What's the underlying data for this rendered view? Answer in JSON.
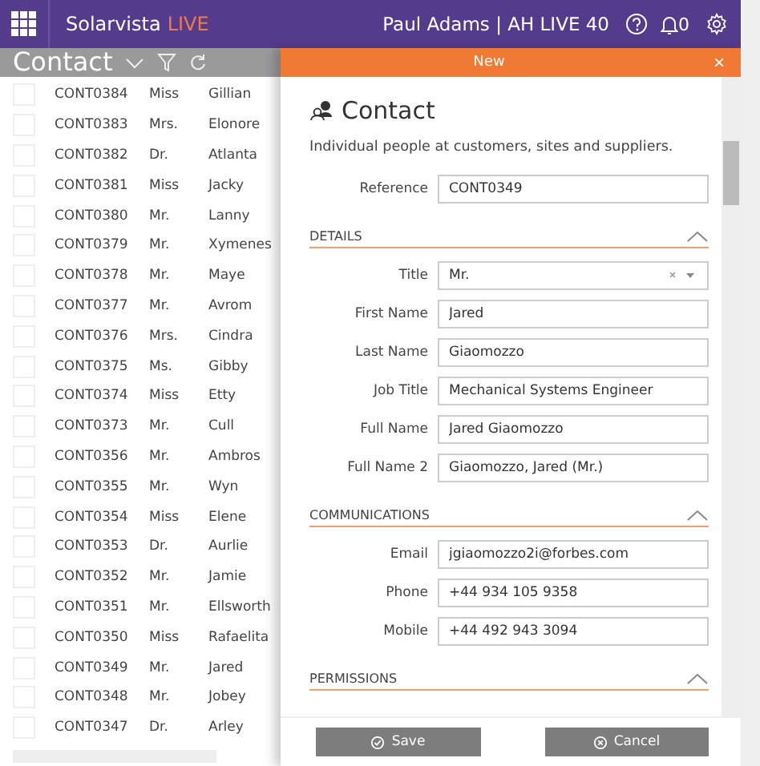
{
  "header": {
    "brand": "Solarvista",
    "brand_suffix": "LIVE",
    "user": "Paul Adams | AH LIVE 40",
    "notifications": "0"
  },
  "list_toolbar": {
    "title": "Contact"
  },
  "rows": [
    {
      "ref": "CONT0384",
      "title": "Miss",
      "name": "Gillian",
      "checked": false
    },
    {
      "ref": "CONT0383",
      "title": "Mrs.",
      "name": "Elonore",
      "checked": false
    },
    {
      "ref": "CONT0382",
      "title": "Dr.",
      "name": "Atlanta",
      "checked": false
    },
    {
      "ref": "CONT0381",
      "title": "Miss",
      "name": "Jacky",
      "checked": false
    },
    {
      "ref": "CONT0380",
      "title": "Mr.",
      "name": "Lanny",
      "checked": false
    },
    {
      "ref": "CONT0379",
      "title": "Mr.",
      "name": "Xymenes",
      "checked": false
    },
    {
      "ref": "CONT0378",
      "title": "Mr.",
      "name": "Maye",
      "checked": false
    },
    {
      "ref": "CONT0377",
      "title": "Mr.",
      "name": "Avrom",
      "checked": false
    },
    {
      "ref": "CONT0376",
      "title": "Mrs.",
      "name": "Cindra",
      "checked": false
    },
    {
      "ref": "CONT0375",
      "title": "Ms.",
      "name": "Gibby",
      "checked": false
    },
    {
      "ref": "CONT0374",
      "title": "Miss",
      "name": "Etty",
      "checked": false
    },
    {
      "ref": "CONT0373",
      "title": "Mr.",
      "name": "Cull",
      "checked": false
    },
    {
      "ref": "CONT0356",
      "title": "Mr.",
      "name": "Ambros",
      "checked": false
    },
    {
      "ref": "CONT0355",
      "title": "Mr.",
      "name": "Wyn",
      "checked": false
    },
    {
      "ref": "CONT0354",
      "title": "Miss",
      "name": "Elene",
      "checked": false
    },
    {
      "ref": "CONT0353",
      "title": "Dr.",
      "name": "Aurlie",
      "checked": false
    },
    {
      "ref": "CONT0352",
      "title": "Mr.",
      "name": "Jamie",
      "checked": false
    },
    {
      "ref": "CONT0351",
      "title": "Mr.",
      "name": "Ellsworth",
      "checked": false
    },
    {
      "ref": "CONT0350",
      "title": "Miss",
      "name": "Rafaelita",
      "checked": false
    },
    {
      "ref": "CONT0349",
      "title": "Mr.",
      "name": "Jared",
      "checked": false
    },
    {
      "ref": "CONT0348",
      "title": "Mr.",
      "name": "Jobey",
      "checked": false
    },
    {
      "ref": "CONT0347",
      "title": "Dr.",
      "name": "Arley",
      "checked": false
    }
  ],
  "panel": {
    "title": "New",
    "heading": "Contact",
    "description": "Individual people at customers, sites and suppliers.",
    "sections": [
      {
        "kind": "plain",
        "fields": [
          {
            "label": "Reference",
            "value": "CONT0349",
            "kind": "text"
          }
        ]
      },
      {
        "kind": "section",
        "title": "DETAILS",
        "fields": [
          {
            "label": "Title",
            "value": "Mr.",
            "kind": "select"
          },
          {
            "label": "First Name",
            "value": "Jared",
            "kind": "text"
          },
          {
            "label": "Last Name",
            "value": "Giaomozzo",
            "kind": "text"
          },
          {
            "label": "Job Title",
            "value": "Mechanical Systems Engineer",
            "kind": "text"
          },
          {
            "label": "Full Name",
            "value": "Jared Giaomozzo",
            "kind": "text"
          },
          {
            "label": "Full Name 2",
            "value": "Giaomozzo, Jared (Mr.)",
            "kind": "text"
          }
        ]
      },
      {
        "kind": "section",
        "title": "COMMUNICATIONS",
        "fields": [
          {
            "label": "Email",
            "value": "jgiaomozzo2i@forbes.com",
            "kind": "text"
          },
          {
            "label": "Phone",
            "value": "+44 934 105 9358",
            "kind": "text"
          },
          {
            "label": "Mobile",
            "value": "+44 492 943 3094",
            "kind": "text"
          }
        ]
      },
      {
        "kind": "section",
        "title": "PERMISSIONS"
      }
    ],
    "close": "×",
    "buttons": [
      {
        "label": "Save",
        "kind": "save"
      },
      {
        "label": "Cancel",
        "kind": "cancel"
      }
    ]
  }
}
